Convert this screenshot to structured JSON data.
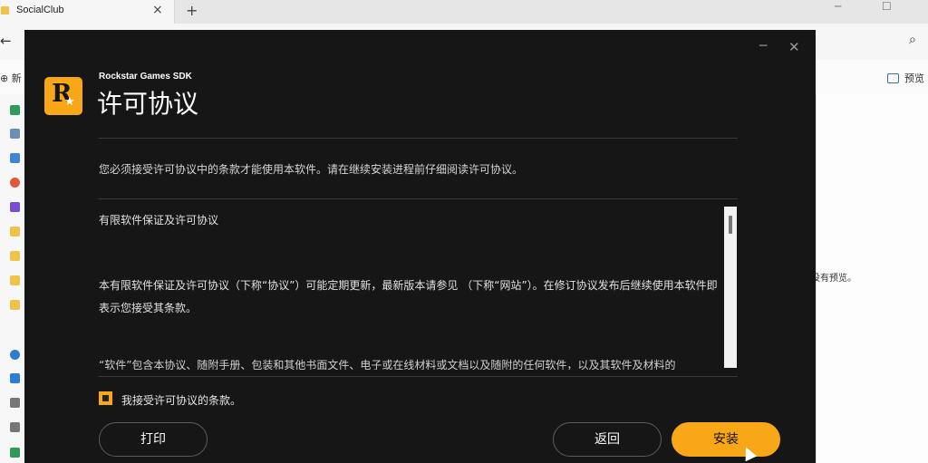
{
  "browser": {
    "tab_title": "SocialClub",
    "tab_close": "×",
    "new_tab": "+",
    "back": "←",
    "window_minimize": "─",
    "window_maximize": "☐",
    "search_icon": "⌕"
  },
  "explorer": {
    "new_label": "⊕ 新",
    "preview_label": "预览",
    "no_preview": "没有预览。"
  },
  "dialog": {
    "sdk_name": "Rockstar Games SDK",
    "title": "许可协议",
    "minimize": "─",
    "close": "✕",
    "intro": "您必须接受许可协议中的条款才能使用本软件。请在继续安装进程前仔细阅读许可协议。",
    "license_heading": "有限软件保证及许可协议",
    "license_paragraph": "本有限软件保证及许可协议（下称“协议”）可能定期更新，最新版本请参见 （下称“网站”）。在修订协议发布后继续使用本软件即表示您接受其条款。",
    "license_cut_line": "“软件”包含本协议、随附手册、包装和其他书面文件、电子或在线材料或文档以及随附的任何软件，以及其软件及材料的",
    "accept_label": "我接受许可协议的条款。",
    "print_button": "打印",
    "back_button": "返回",
    "install_button": "安装"
  },
  "colors": {
    "accent": "#f8a717",
    "dialog_bg": "#161616"
  }
}
